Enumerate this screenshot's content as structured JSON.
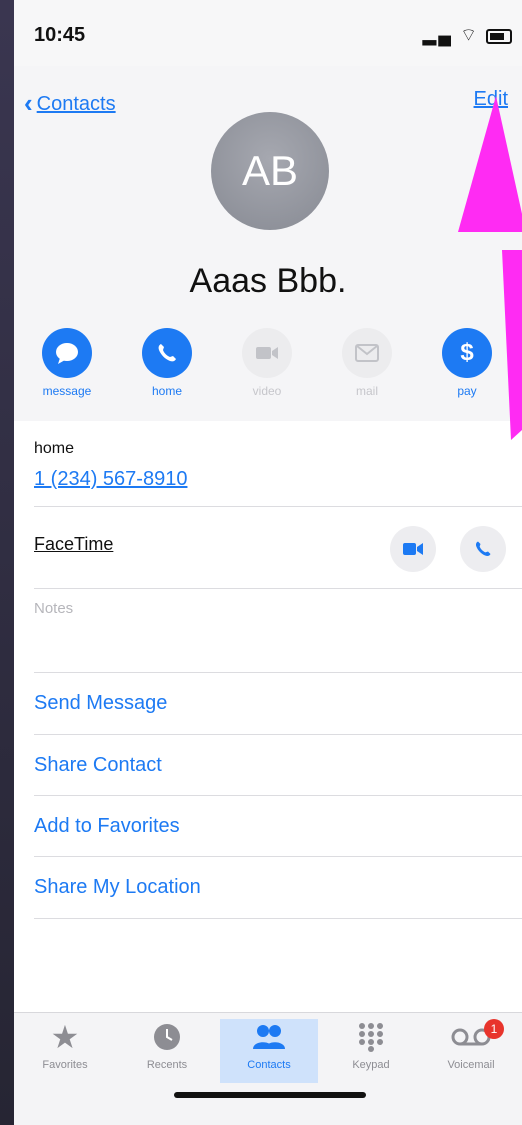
{
  "status_bar": {
    "time": "10:45"
  },
  "nav": {
    "back_label": "Contacts",
    "edit_label": "Edit"
  },
  "contact": {
    "initials": "AB",
    "name": "Aaas Bbb."
  },
  "actions": [
    {
      "label": "message",
      "enabled": true
    },
    {
      "label": "home",
      "enabled": true
    },
    {
      "label": "video",
      "enabled": false
    },
    {
      "label": "mail",
      "enabled": false
    },
    {
      "label": "pay",
      "enabled": true
    }
  ],
  "phone": {
    "label": "home",
    "number": "1 (234) 567-8910"
  },
  "facetime": {
    "label": "FaceTime"
  },
  "notes": {
    "label": "Notes"
  },
  "list": [
    "Send Message",
    "Share Contact",
    "Add to Favorites",
    "Share My Location"
  ],
  "tabs": [
    {
      "label": "Favorites",
      "active": false
    },
    {
      "label": "Recents",
      "active": false
    },
    {
      "label": "Contacts",
      "active": true
    },
    {
      "label": "Keypad",
      "active": false
    },
    {
      "label": "Voicemail",
      "active": false,
      "badge": "1"
    }
  ],
  "colors": {
    "accent": "#1d7af3",
    "annotation": "#ff2bf3",
    "badge": "#e8342c"
  }
}
